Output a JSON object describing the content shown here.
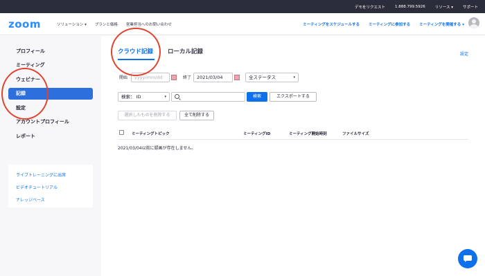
{
  "topbar": {
    "demo": "デモをリクエスト",
    "phone": "1.888.799.5926",
    "resources": "リソース ▾",
    "support": "サポート"
  },
  "header": {
    "logo": "zoom",
    "nav_left": [
      "ソリューション ▾",
      "プランと価格",
      "営業担当へのお問い合わせ"
    ],
    "nav_right": [
      "ミーティングをスケジュールする",
      "ミーティングに参加する",
      "ミーティングを開催する ▾"
    ]
  },
  "sidebar": {
    "items": [
      "プロフィール",
      "ミーティング",
      "ウェビナー",
      "記録",
      "設定",
      "アカウントプロフィール",
      "レポート"
    ],
    "active_index": 3,
    "help": [
      "ライブトレーニングに出席",
      "ビデオチュートリアル",
      "ナレッジベース"
    ]
  },
  "main": {
    "tabs": [
      "クラウド記録",
      "ローカル記録"
    ],
    "settings_link": "設定",
    "filters": {
      "start_label": "開始",
      "start_placeholder": "yyyy/mm/dd",
      "end_label": "終了",
      "end_value": "2021/03/04",
      "status_value": "全ステータス",
      "search_type_value": "検索： ID",
      "search_button": "検索",
      "export_button": "エクスポートする"
    },
    "actions": {
      "delete_selected": "選択したものを削除する",
      "delete_all": "全て削除する"
    },
    "table": {
      "headers": [
        "ミーティングトピック",
        "ミーティングID",
        "ミーティング開始時刻",
        "ファイルサイズ"
      ]
    },
    "empty_message": "2021/03/04以前に録画が存在しません。"
  },
  "colors": {
    "accent": "#0e71eb",
    "active_sidebar": "#2d6fdc",
    "annotation_circle": "#e0442e"
  }
}
